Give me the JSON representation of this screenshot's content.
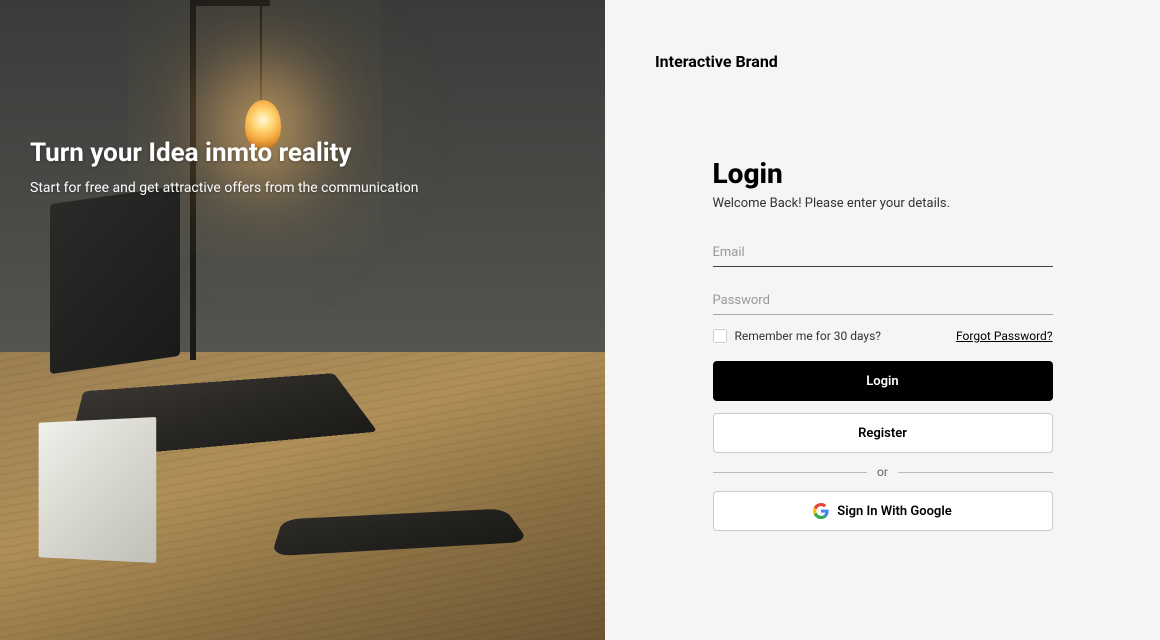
{
  "hero": {
    "title": "Turn your Idea inmto reality",
    "subtitle": "Start for free and get attractive offers from the communication"
  },
  "brand": "Interactive Brand",
  "login": {
    "title": "Login",
    "subtitle": "Welcome Back! Please enter your details.",
    "email_placeholder": "Email",
    "password_placeholder": "Password",
    "remember_label": "Remember me for 30 days?",
    "forgot_label": "Forgot Password?",
    "login_button": "Login",
    "register_button": "Register",
    "or_label": "or",
    "google_button": "Sign In With Google"
  }
}
